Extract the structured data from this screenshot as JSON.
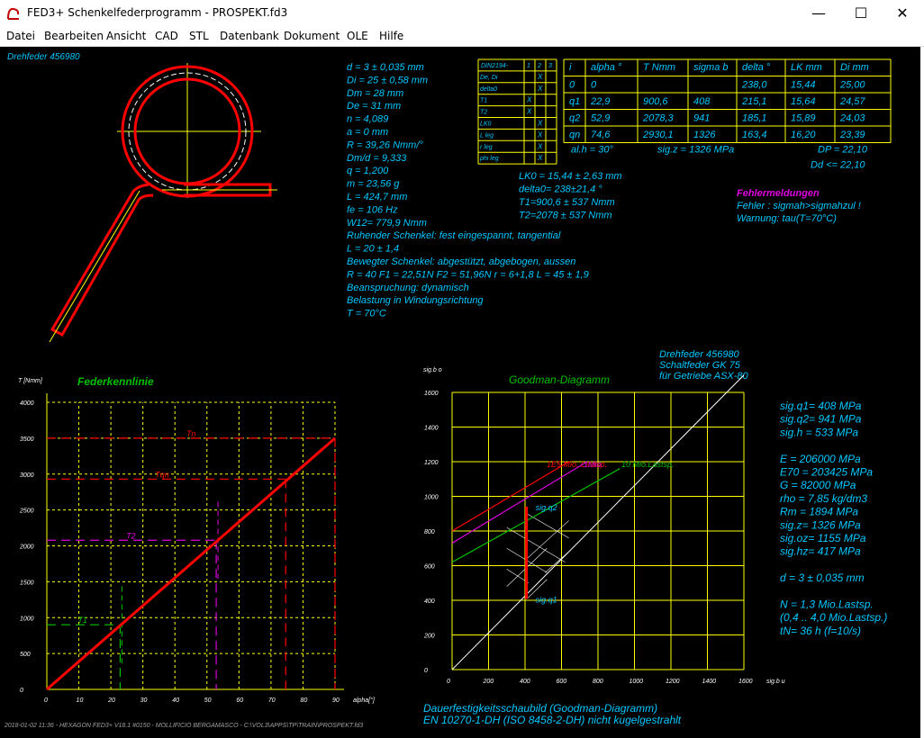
{
  "window": {
    "title": "FED3+  Schenkelfederprogramm  -  PROSPEKT.fd3",
    "minimize": "—",
    "maximize": "☐",
    "close": "✕"
  },
  "menu": [
    "Datei",
    "Bearbeiten",
    "Ansicht",
    "CAD",
    "STL",
    "Datenbank",
    "Dokument",
    "OLE",
    "Hilfe"
  ],
  "spring_label": "Drehfeder  456980",
  "parameters": [
    "d = 3 ± 0,035 mm",
    "Di = 25 ± 0,58 mm",
    "Dm = 28 mm",
    "De = 31 mm",
    "n = 4,089",
    "a = 0 mm",
    "R = 39,26 Nmm/°",
    "Dm/d = 9,333",
    "q = 1,200",
    "m = 23,56 g",
    "L = 424,7 mm",
    "fe = 106 Hz",
    "W12= 779,9 Nmm",
    "Ruhender Schenkel: fest eingespannt, tangential",
    "L = 20 ± 1,4",
    "Bewegter Schenkel: abgestützt, abgebogen, aussen",
    "R = 40   F1 = 22,51N   F2 = 51,96N   r = 6+1,8    L = 45 ± 1,9",
    "Beanspruchung: dynamisch",
    "Belastung in Windungsrichtung",
    "T = 70°C"
  ],
  "din_table": {
    "header": [
      "DIN2194-",
      "1",
      "2",
      "3"
    ],
    "rows": [
      {
        "label": "De, Di",
        "c1": "",
        "c2": "X",
        "c3": ""
      },
      {
        "label": "delta0",
        "c1": "",
        "c2": "X",
        "c3": ""
      },
      {
        "label": "T1",
        "c1": "X",
        "c2": "",
        "c3": ""
      },
      {
        "label": "T2",
        "c1": "X",
        "c2": "",
        "c3": ""
      },
      {
        "label": "LK0",
        "c1": "",
        "c2": "X",
        "c3": ""
      },
      {
        "label": "L leg",
        "c1": "",
        "c2": "X",
        "c3": ""
      },
      {
        "label": "r leg",
        "c1": "",
        "c2": "X",
        "c3": ""
      },
      {
        "label": "phi leg",
        "c1": "",
        "c2": "X",
        "c3": ""
      }
    ]
  },
  "load_table": {
    "header": [
      "i",
      "alpha °",
      "T  Nmm",
      "sigma b",
      "delta °",
      "LK mm",
      "Di mm"
    ],
    "rows": [
      [
        "0",
        "0",
        "",
        "",
        "238,0",
        "15,44",
        "25,00"
      ],
      [
        "q1",
        "22,9",
        "900,6",
        "408",
        "215,1",
        "15,64",
        "24,57"
      ],
      [
        "q2",
        "52,9",
        "2078,3",
        "941",
        "185,1",
        "15,89",
        "24,03"
      ],
      [
        "qn",
        "74,6",
        "2930,1",
        "1326",
        "163,4",
        "16,20",
        "23,39"
      ]
    ],
    "footer_left": "al.h = 30°",
    "footer_mid": "sig.z = 1326 MPa",
    "footer_right1": "DP = 22,10",
    "footer_right2": "Dd <= 22,10"
  },
  "tolerances": [
    "LK0 = 15,44 ± 2,63 mm",
    "delta0= 238±21,4 °",
    "T1=900,6 ± 537 Nmm",
    "T2=2078 ± 537 Nmm"
  ],
  "errors": {
    "title": "Fehlermeldungen",
    "lines": [
      "Fehler : sigmah>sigmahzul !",
      "Warnung: tau(T=70°C)"
    ]
  },
  "chart_data": [
    {
      "type": "line",
      "title": "Federkennlinie",
      "xlabel": "alpha[°]",
      "ylabel": "T [Nmm]",
      "xlim": [
        0,
        90
      ],
      "ylim": [
        0,
        4000
      ],
      "xticks": [
        "0",
        "10",
        "20",
        "30",
        "40",
        "50",
        "60",
        "70",
        "80",
        "90"
      ],
      "yticks": [
        "0",
        "500",
        "1000",
        "1500",
        "2000",
        "2500",
        "3000",
        "3500",
        "4000"
      ],
      "grid": true,
      "series": [
        {
          "name": "",
          "color": "#ff0000",
          "x": [
            0,
            90
          ],
          "y": [
            0,
            3500
          ]
        }
      ],
      "markers": [
        {
          "label": "T1",
          "alpha": 22.9,
          "T": 900.6,
          "color": "#00c000"
        },
        {
          "label": "T2",
          "alpha": 52.9,
          "T": 2078.3,
          "color": "#e000e0"
        },
        {
          "label": "Tqn",
          "alpha": 74.6,
          "T": 2930.1,
          "color": "#ff0000"
        },
        {
          "label": "Tn",
          "alpha": 90,
          "T": 3500,
          "color": "#ff0000"
        }
      ]
    },
    {
      "type": "line",
      "title": "Goodman-Diagramm",
      "xlabel": "sig.b u",
      "ylabel": "sig.b o",
      "xlim": [
        0,
        1600
      ],
      "ylim": [
        0,
        1600
      ],
      "xticks": [
        "0",
        "200",
        "400",
        "600",
        "800",
        "1000",
        "1200",
        "1400",
        "1600"
      ],
      "yticks": [
        "0",
        "200",
        "400",
        "600",
        "800",
        "1000",
        "1200",
        "1400",
        "1600"
      ],
      "grid": true,
      "series": [
        {
          "name": "",
          "color": "#ffffff",
          "x": [
            0,
            1600
          ],
          "y": [
            0,
            1700
          ]
        },
        {
          "name": "1E5 Mio. Lastsp.",
          "color": "#ff0000",
          "x": [
            0,
            640
          ],
          "y": [
            800,
            1200
          ]
        },
        {
          "name": "1Mio.",
          "color": "#e000e0",
          "x": [
            0,
            740
          ],
          "y": [
            730,
            1200
          ]
        },
        {
          "name": "10 Mio.Lastsp.",
          "color": "#00c000",
          "x": [
            0,
            920
          ],
          "y": [
            620,
            1160
          ]
        }
      ],
      "annotations": [
        {
          "label": "sig.q1",
          "x": 408,
          "y": 408
        },
        {
          "label": "sig.q2",
          "x": 408,
          "y": 941
        }
      ],
      "header": [
        "Drehfeder  456980",
        "Schaltfeder GK 75",
        "für Getriebe ASX-80"
      ]
    }
  ],
  "material": [
    "sig.q1=  408 MPa",
    "sig.q2=  941 MPa",
    "sig.h =  533 MPa",
    "",
    "E = 206000 MPa",
    "E70 = 203425 MPa",
    "G =  82000 MPa",
    "rho =  7,85 kg/dm3",
    "Rm = 1894 MPa",
    "sig.z= 1326 MPa",
    "sig.oz= 1155 MPa",
    "sig.hz=  417 MPa",
    "",
    "d = 3 ± 0,035 mm",
    "",
    "N = 1,3 Mio.Lastsp.",
    "(0,4 .. 4,0 Mio.Lastsp.)",
    "tN= 36 h  (f=10/s)"
  ],
  "goodman_caption": [
    "Dauerfestigkeitsschaubild (Goodman-Diagramm)",
    "EN 10270-1-DH (ISO 8458-2-DH) nicht kugelgestrahlt"
  ],
  "status_line": "2018-01-02 11:36 - HEXAGON FED3+ V18.1 #0150 - MOLLIFICIO BERGAMASCO - C:\\VOL3\\APPS\\TP\\TRAIN\\PROSPEKT.fd3"
}
